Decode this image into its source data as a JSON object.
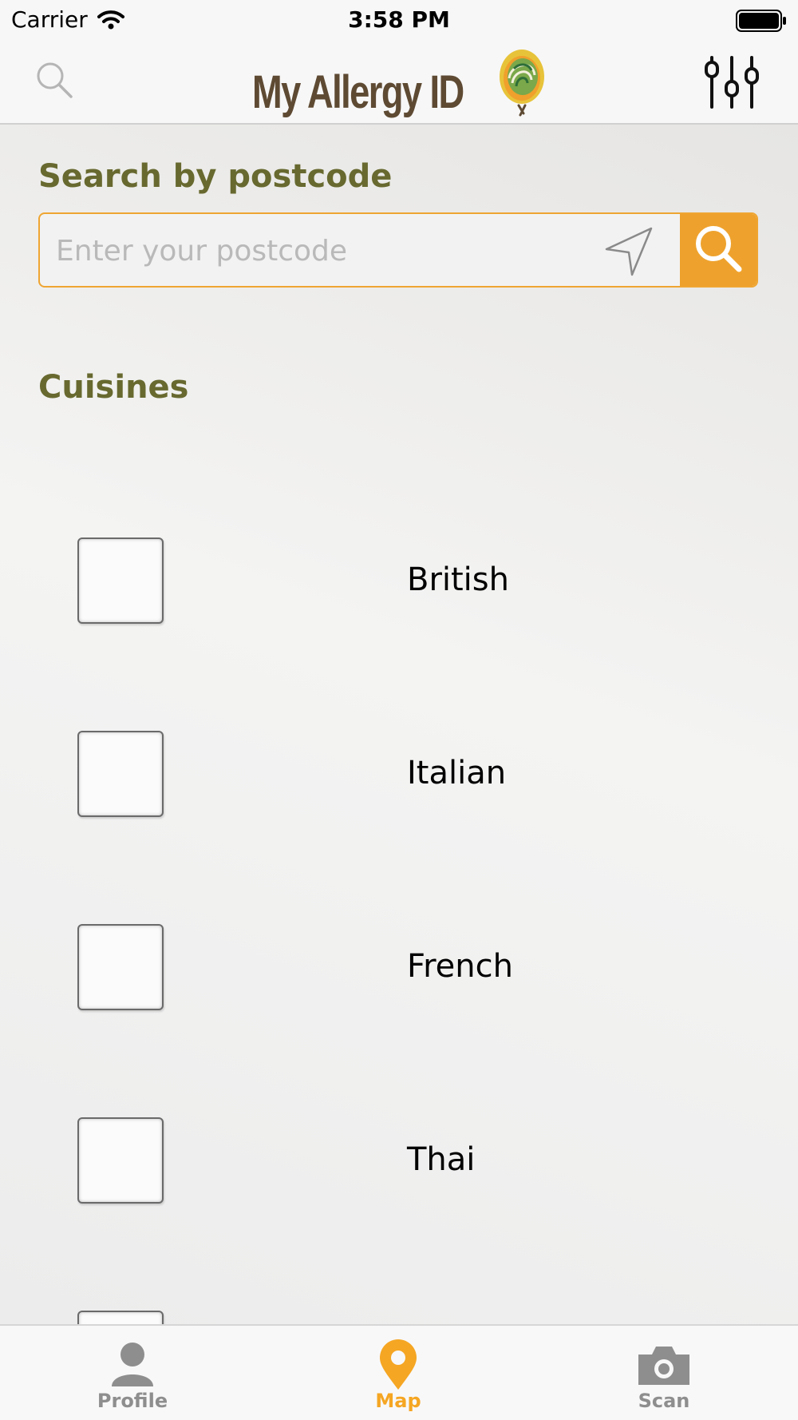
{
  "status_bar": {
    "carrier": "Carrier",
    "time": "3:58 PM"
  },
  "header": {
    "logo_text": "My Allergy ID",
    "search_icon": "search-icon",
    "filter_icon": "sliders-icon"
  },
  "postcode_search": {
    "title": "Search by postcode",
    "placeholder": "Enter your postcode",
    "value": "",
    "locate_icon": "location-arrow-icon",
    "button_icon": "search-icon"
  },
  "cuisines": {
    "title": "Cuisines",
    "items": [
      {
        "label": "British",
        "checked": false
      },
      {
        "label": "Italian",
        "checked": false
      },
      {
        "label": "French",
        "checked": false
      },
      {
        "label": "Thai",
        "checked": false
      }
    ]
  },
  "tab_bar": {
    "tabs": [
      {
        "label": "Profile",
        "icon": "person-icon",
        "active": false
      },
      {
        "label": "Map",
        "icon": "map-pin-icon",
        "active": true
      },
      {
        "label": "Scan",
        "icon": "camera-icon",
        "active": false
      }
    ],
    "active_color": "#F5A623",
    "inactive_color": "#8E8E8E"
  },
  "colors": {
    "accent": "#EEA22D",
    "section_title": "#67692F",
    "logo_brown": "#5E4A33"
  }
}
